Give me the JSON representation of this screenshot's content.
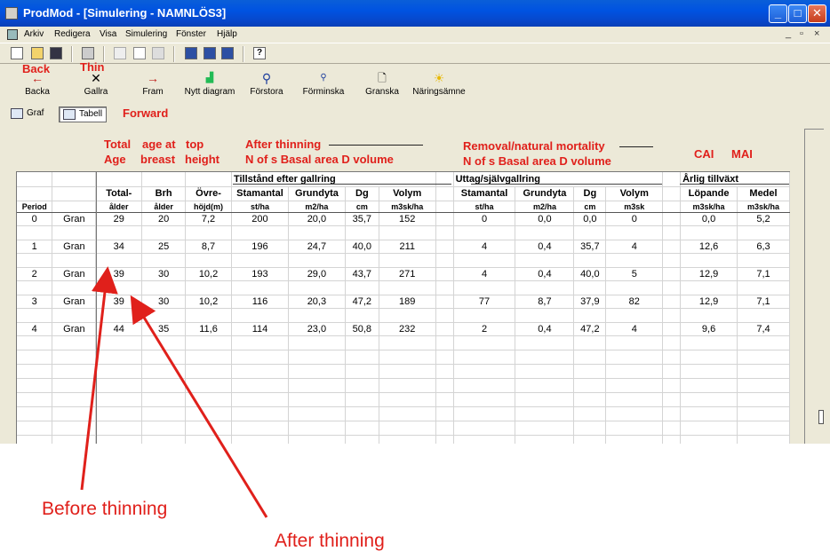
{
  "window": {
    "title": "ProdMod - [Simulering - NAMNLÖS3]",
    "controls": {
      "minimize": "_",
      "maximize": "□",
      "close": "✕"
    }
  },
  "menubar": {
    "items": [
      "Arkiv",
      "Redigera",
      "Visa",
      "Simulering",
      "Fönster",
      "Hjälp"
    ],
    "mdi_controls": [
      "_",
      "▫",
      "×"
    ]
  },
  "toolbar": {
    "buttons": [
      {
        "icon": "back-arrow-icon",
        "label": "Backa"
      },
      {
        "icon": "x-icon",
        "label": "Gallra"
      },
      {
        "icon": "forward-arrow-icon",
        "label": "Fram"
      },
      {
        "icon": "chart-icon",
        "label": "Nytt diagram"
      },
      {
        "icon": "magnifier-icon",
        "label": "Förstora"
      },
      {
        "icon": "magnifier-small-icon",
        "label": "Förminska"
      },
      {
        "icon": "inspect-icon",
        "label": "Granska"
      },
      {
        "icon": "sun-icon",
        "label": "Näringsämne"
      }
    ]
  },
  "viewbar": {
    "graf": "Graf",
    "tabell": "Tabell"
  },
  "annotations": {
    "back": "Back",
    "thin": "Thin",
    "forward": "Forward",
    "total_age_1": "Total",
    "total_age_2": "Age",
    "age_at_1": "age at",
    "age_at_2": "breast",
    "top_1": "top",
    "top_2": "height",
    "after_thinning_1": "After thinning",
    "after_thinning_2": "N of s   Basal area    D      volume",
    "removal_1": "Removal/natural mortality",
    "removal_2": "N of s  Basal area    D      volume",
    "cai": "CAI",
    "mai": "MAI",
    "before_thinning_big": "Before thinning",
    "after_thinning_big": "After thinning"
  },
  "table": {
    "groups": {
      "after": "Tillstånd efter gallring",
      "removal": "Uttag/självgallring",
      "growth": "Årlig tillväxt"
    },
    "headers": [
      "",
      "",
      "Total-",
      "Brh",
      "Övre-",
      "Stamantal",
      "Grundyta",
      "Dg",
      "Volym",
      "",
      "Stamantal",
      "Grundyta",
      "Dg",
      "Volym",
      "",
      "Löpande",
      "Medel"
    ],
    "units": [
      "Period",
      "",
      "ålder",
      "ålder",
      "höjd(m)",
      "st/ha",
      "m2/ha",
      "cm",
      "m3sk/ha",
      "",
      "st/ha",
      "m2/ha",
      "cm",
      "m3sk",
      "",
      "m3sk/ha",
      "m3sk/ha"
    ],
    "rows": [
      [
        "0",
        "Gran",
        "29",
        "20",
        "7,2",
        "200",
        "20,0",
        "35,7",
        "152",
        "",
        "0",
        "0,0",
        "0,0",
        "0",
        "",
        "0,0",
        "5,2"
      ],
      [
        "1",
        "Gran",
        "34",
        "25",
        "8,7",
        "196",
        "24,7",
        "40,0",
        "211",
        "",
        "4",
        "0,4",
        "35,7",
        "4",
        "",
        "12,6",
        "6,3"
      ],
      [
        "2",
        "Gran",
        "39",
        "30",
        "10,2",
        "193",
        "29,0",
        "43,7",
        "271",
        "",
        "4",
        "0,4",
        "40,0",
        "5",
        "",
        "12,9",
        "7,1"
      ],
      [
        "3",
        "Gran",
        "39",
        "30",
        "10,2",
        "116",
        "20,3",
        "47,2",
        "189",
        "",
        "77",
        "8,7",
        "37,9",
        "82",
        "",
        "12,9",
        "7,1"
      ],
      [
        "4",
        "Gran",
        "44",
        "35",
        "11,6",
        "114",
        "23,0",
        "50,8",
        "232",
        "",
        "2",
        "0,4",
        "47,2",
        "4",
        "",
        "9,6",
        "7,4"
      ]
    ]
  }
}
